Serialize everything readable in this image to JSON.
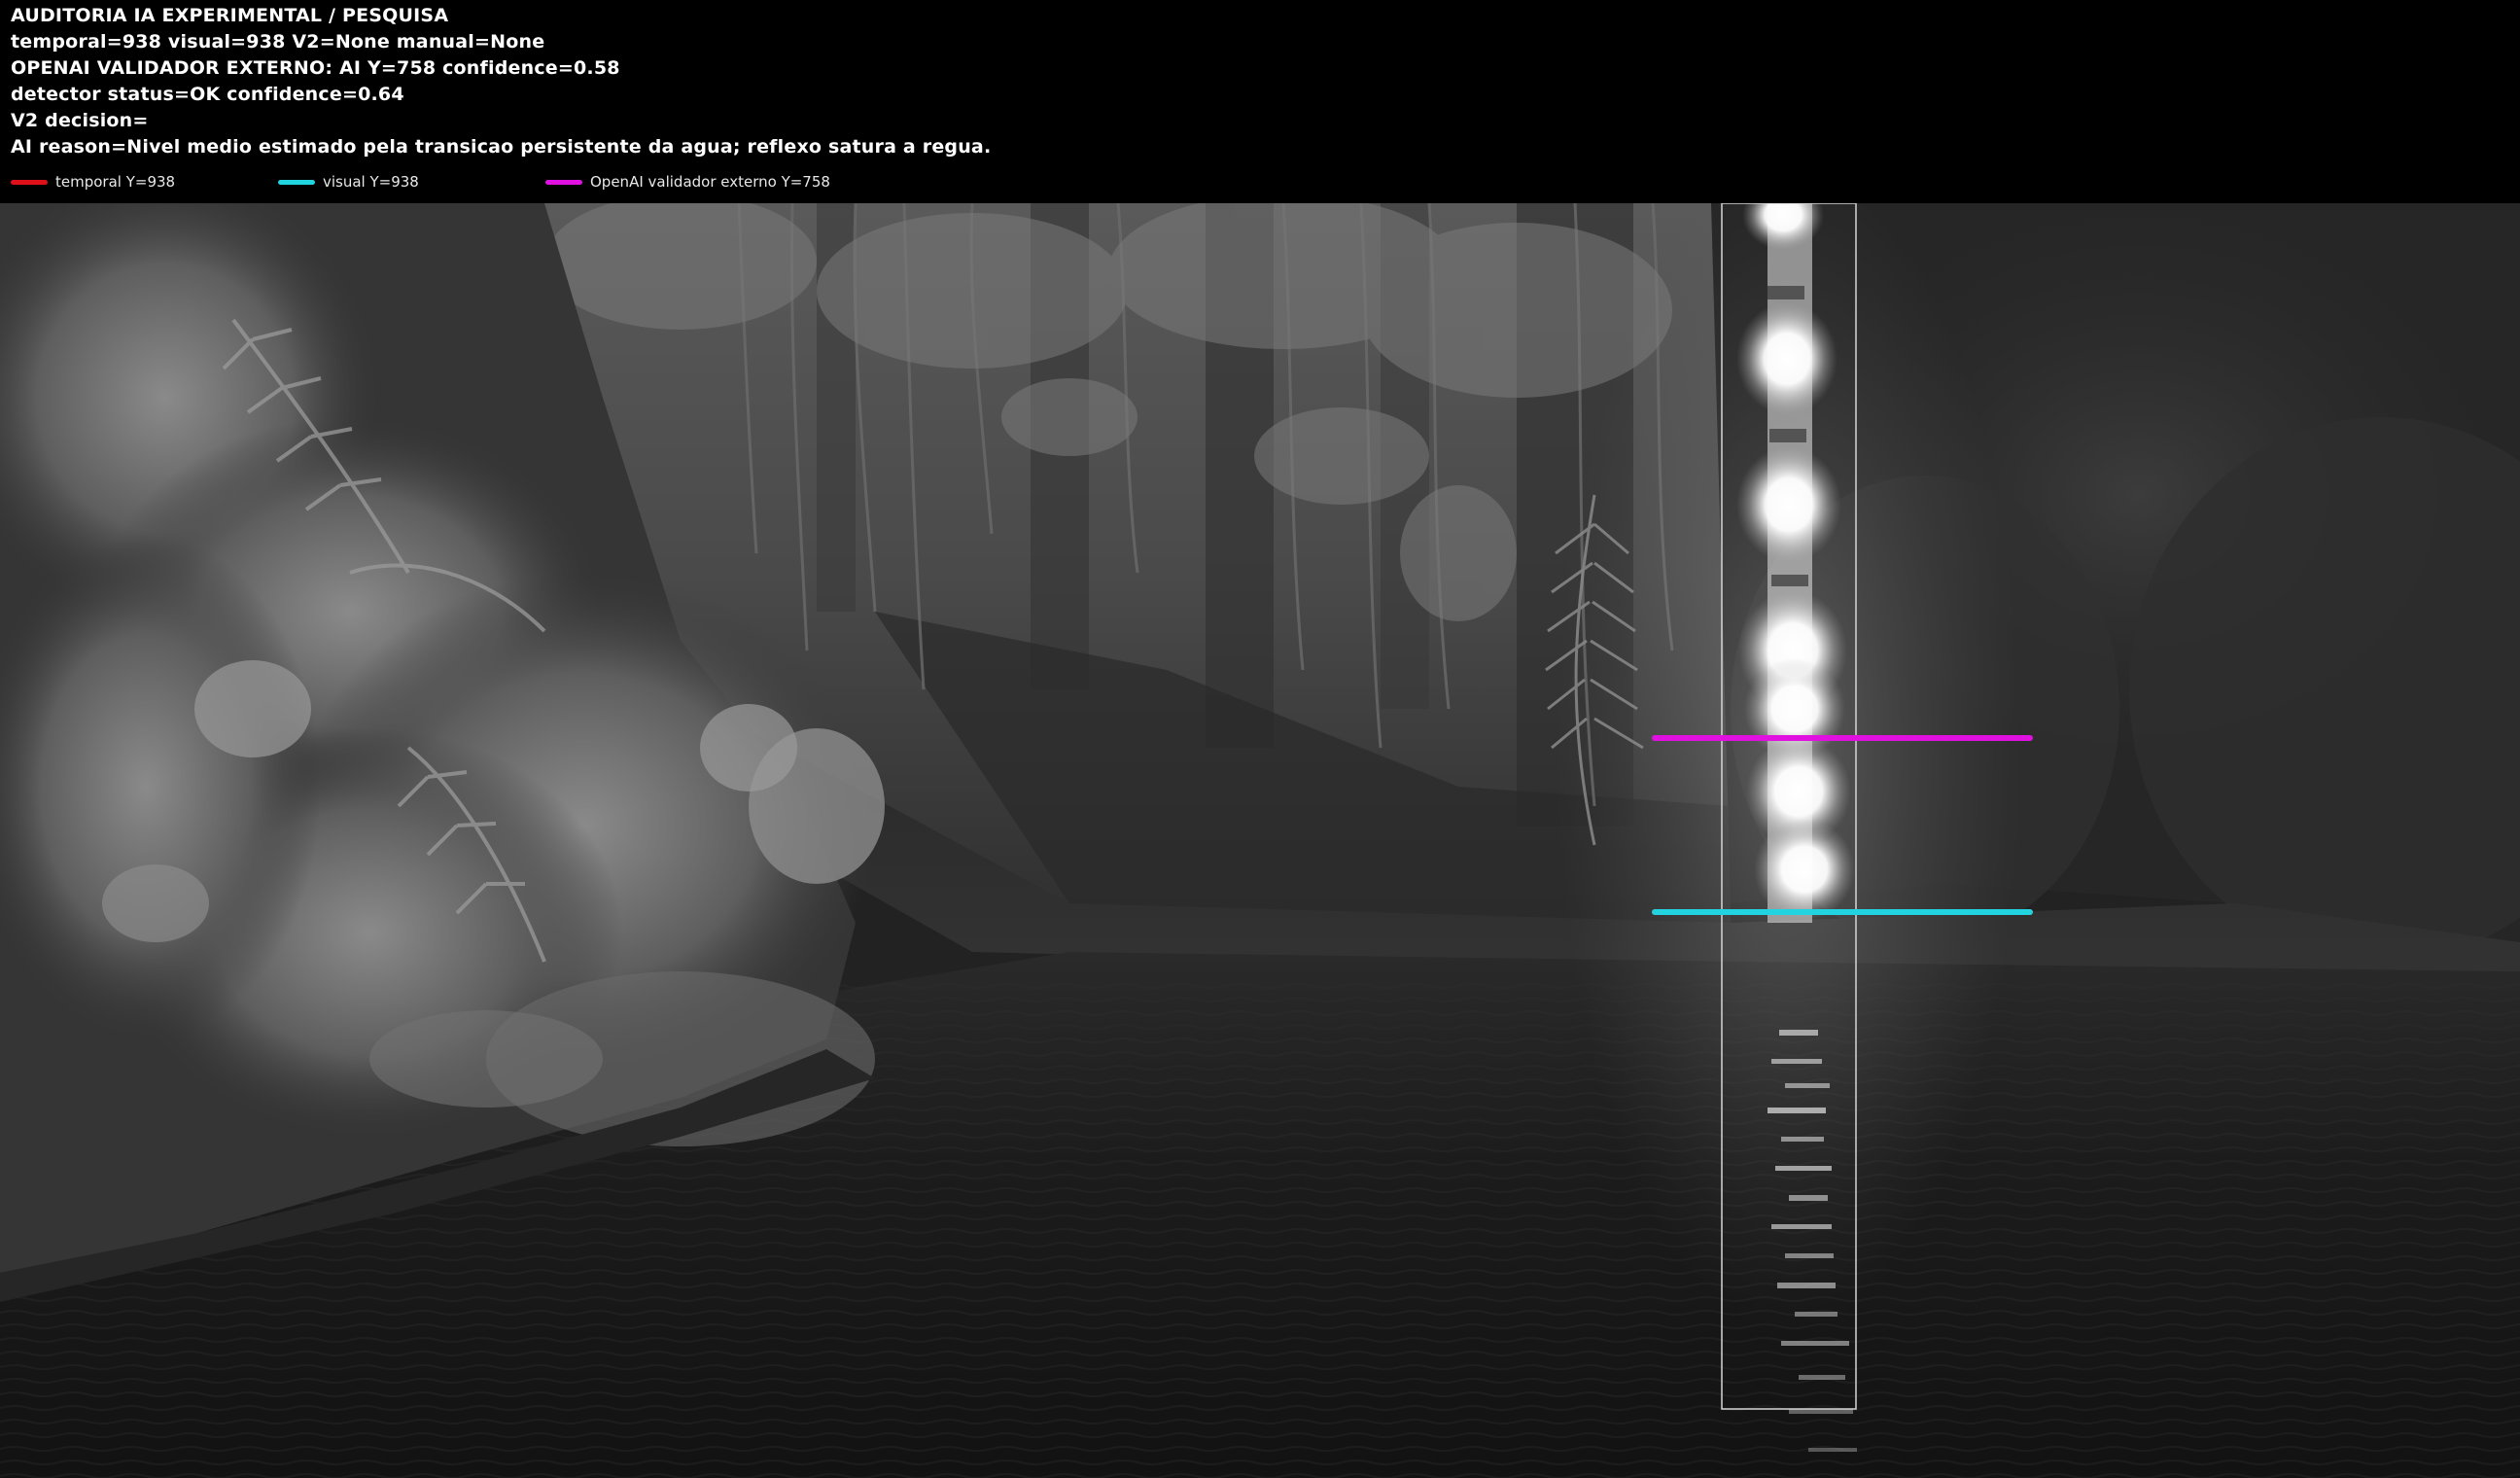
{
  "audit": {
    "lines": [
      "AUDITORIA IA  EXPERIMENTAL / PESQUISA",
      "temporal=938  visual=938  V2=None  manual=None",
      "OPENAI  VALIDADOR EXTERNO: AI Y=758  confidence=0.58",
      "detector status=OK confidence=0.64",
      "V2 decision=",
      "AI reason=Nivel medio estimado pela transicao persistente da agua; reflexo satura a regua."
    ]
  },
  "legend": [
    {
      "label": "temporal Y=938",
      "color": "#e0101a"
    },
    {
      "label": "visual Y=938",
      "color": "#22d4e0"
    },
    {
      "label": "OpenAI validador externo Y=758",
      "color": "#e010e0"
    }
  ],
  "markers": {
    "openai_color": "#e010e0",
    "visual_color": "#22d4e0",
    "temporal_color": "#e0101a"
  }
}
